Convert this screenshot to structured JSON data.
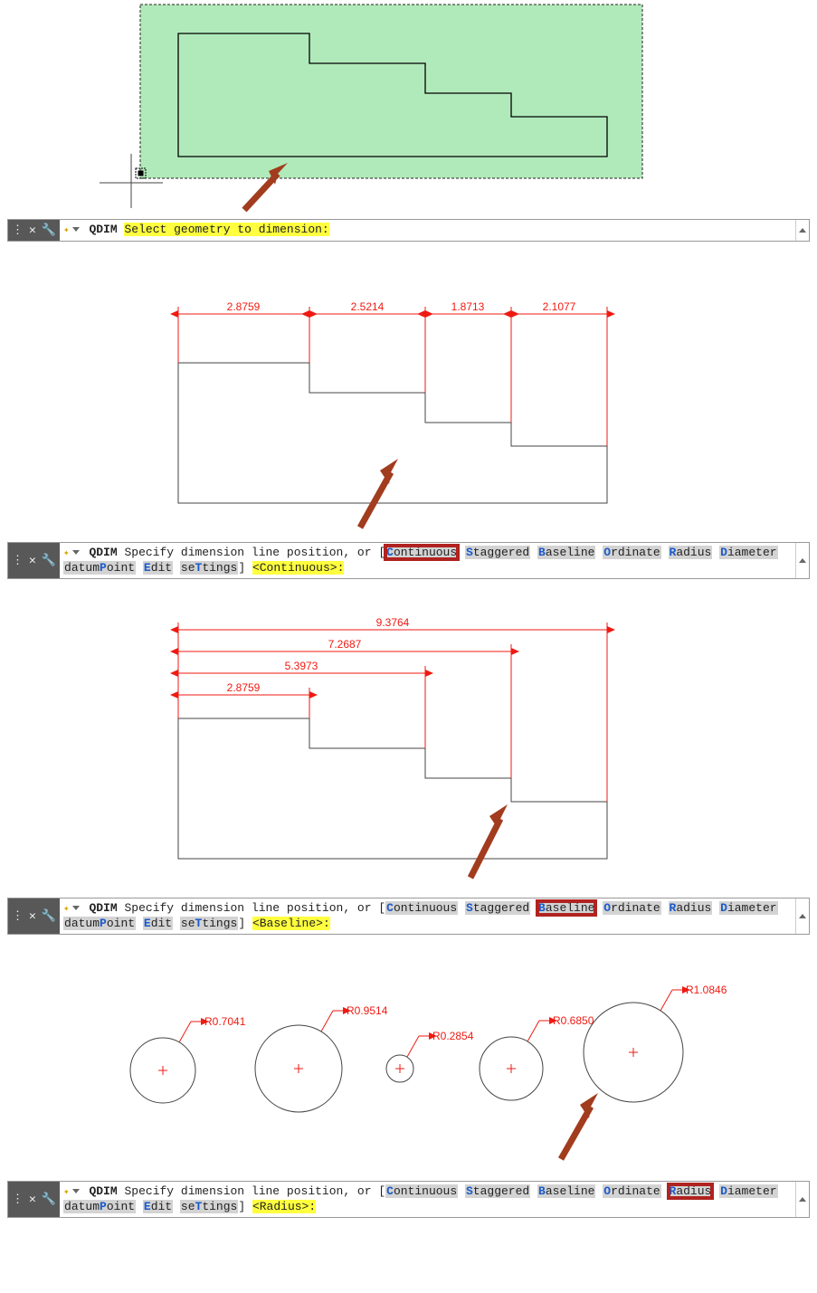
{
  "cmd1": {
    "name": "QDIM",
    "prompt_hl": "Select geometry to dimension:"
  },
  "cmd2": {
    "name": "QDIM",
    "prompt": "Specify dimension line position, or",
    "opts": {
      "continuous_pre": "",
      "continuous_key": "C",
      "continuous_rest": "ontinuous",
      "staggered_key": "S",
      "staggered_rest": "taggered",
      "baseline_key": "B",
      "baseline_rest": "aseline",
      "ordinate_key": "O",
      "ordinate_rest": "rdinate",
      "radius_key": "R",
      "radius_rest": "adius",
      "diameter_key": "D",
      "diameter_rest": "iameter",
      "datum_pre": "datum",
      "datum_key": "P",
      "datum_rest": "oint",
      "edit_key": "E",
      "edit_rest": "dit",
      "settings_pre": "se",
      "settings_key": "T",
      "settings_rest": "tings"
    },
    "default_hl": "<Continuous>:"
  },
  "cmd3": {
    "name": "QDIM",
    "prompt": "Specify dimension line position, or",
    "default_hl": "<Baseline>:"
  },
  "cmd4": {
    "name": "QDIM",
    "prompt": "Specify dimension line position, or",
    "default_hl": "<Radius>:"
  },
  "dims_continuous": [
    "2.8759",
    "2.5214",
    "1.8713",
    "2.1077"
  ],
  "dims_baseline": [
    "2.8759",
    "5.3973",
    "7.2687",
    "9.3764"
  ],
  "radii": [
    "R0.7041",
    "R0.9514",
    "R0.2854",
    "R0.6850",
    "R1.0846"
  ]
}
